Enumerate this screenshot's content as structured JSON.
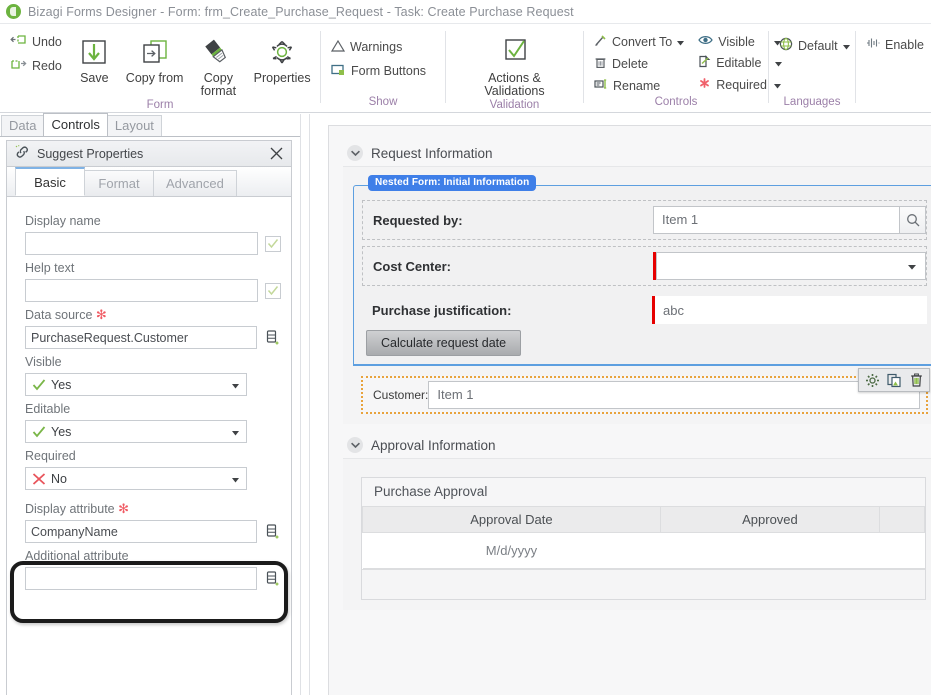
{
  "window": {
    "title": "Bizagi Forms Designer  - Form: frm_Create_Purchase_Request - Task:  Create Purchase Request",
    "logo_icon": "bizagi-logo-icon"
  },
  "ribbon": {
    "groups": [
      {
        "label": "Form",
        "small_items": [
          {
            "label": "Undo",
            "icon": "undo-icon"
          },
          {
            "label": "Redo",
            "icon": "redo-icon"
          }
        ],
        "big_items": [
          {
            "label": "Save",
            "icon": "save-icon"
          },
          {
            "label": "Copy from",
            "icon": "copy-from-icon"
          },
          {
            "label": "Copy format",
            "icon": "copy-format-icon"
          },
          {
            "label": "Properties",
            "icon": "properties-gear-icon"
          }
        ]
      },
      {
        "label": "Show",
        "small_items": [
          {
            "label": "Warnings",
            "icon": "warning-triangle-icon"
          },
          {
            "label": "Form Buttons",
            "icon": "form-buttons-icon"
          }
        ],
        "big_items": []
      },
      {
        "label": "Validation",
        "small_items": [],
        "big_items": [
          {
            "label": "Actions & Validations",
            "icon": "checkmark-box-icon"
          }
        ]
      },
      {
        "label": "Controls",
        "small_items": [
          {
            "label": "Convert To",
            "icon": "convert-to-icon",
            "dropdown": true
          },
          {
            "label": "Delete",
            "icon": "trash-icon",
            "dropdown": false
          },
          {
            "label": "Rename",
            "icon": "rename-icon",
            "dropdown": false
          }
        ],
        "small_items_2": [
          {
            "label": "Visible",
            "icon": "eye-icon",
            "dropdown": true
          },
          {
            "label": "Editable",
            "icon": "editable-page-icon",
            "dropdown": true
          },
          {
            "label": "Required",
            "icon": "required-asterisk-icon",
            "dropdown": true
          }
        ],
        "big_items": []
      },
      {
        "label": "Languages",
        "small_items": [
          {
            "label": "Default",
            "icon": "globe-icon",
            "dropdown": true
          }
        ],
        "big_items": []
      },
      {
        "label": "",
        "small_items": [
          {
            "label": "Enable",
            "icon": "enable-icon",
            "dropdown": false
          }
        ],
        "big_items": []
      }
    ]
  },
  "left_panel": {
    "tabs": [
      {
        "label": "Data",
        "active": false
      },
      {
        "label": "Controls",
        "active": true
      },
      {
        "label": "Layout",
        "active": false
      }
    ],
    "properties": {
      "header_title": "Suggest Properties",
      "header_icon": "suggest-link-icon",
      "close_icon": "close-icon",
      "subtabs": [
        {
          "label": "Basic",
          "active": true
        },
        {
          "label": "Format",
          "active": false
        },
        {
          "label": "Advanced",
          "active": false
        }
      ],
      "fields": [
        {
          "label": "Display name",
          "value": "",
          "type": "text-check",
          "required": false
        },
        {
          "label": "Help text",
          "value": "",
          "type": "text-check",
          "required": false
        },
        {
          "label": "Data source",
          "value": "PurchaseRequest.Customer",
          "type": "text-db",
          "required": true
        },
        {
          "label": "Visible",
          "value": "Yes",
          "type": "select-yes",
          "required": false
        },
        {
          "label": "Editable",
          "value": "Yes",
          "type": "select-yes",
          "required": false
        },
        {
          "label": "Required",
          "value": "No",
          "type": "select-no",
          "required": false
        },
        {
          "label": "Display attribute",
          "value": "CompanyName",
          "type": "text-db",
          "required": true,
          "highlighted": true
        },
        {
          "label": "Additional attribute",
          "value": "",
          "type": "text-db",
          "required": false
        }
      ]
    }
  },
  "form": {
    "sections": [
      {
        "title": "Request Information",
        "collapse_icon": "chevron-down-icon",
        "nested_form_badge": "Nested Form: Initial Information",
        "rows": [
          {
            "label": "Requested by:",
            "value": "Item 1",
            "control": "search",
            "required": false,
            "icon": "search-icon"
          },
          {
            "label": "Cost Center:",
            "value": "",
            "control": "dropdown",
            "required": true,
            "icon": "chevron-down-icon"
          },
          {
            "label": "Purchase justification:",
            "value": "abc",
            "control": "text",
            "required": true
          }
        ],
        "button": {
          "label": "Calculate request date"
        },
        "selected_row": {
          "label": "Customer:",
          "value": "Item 1",
          "tools": [
            {
              "icon": "gear-icon",
              "name": "configure"
            },
            {
              "icon": "duplicate-icon",
              "name": "duplicate"
            },
            {
              "icon": "trash-icon",
              "name": "delete"
            }
          ]
        }
      },
      {
        "title": "Approval Information",
        "collapse_icon": "chevron-down-icon",
        "table": {
          "caption": "Purchase Approval",
          "columns": [
            "Approval Date",
            "Approved",
            ""
          ],
          "rows": [
            [
              "M/d/yyyy",
              "",
              ""
            ]
          ]
        }
      }
    ]
  },
  "colors": {
    "brand_green": "#6cb33f",
    "accent_blue": "#3f7fe8",
    "required_red": "#e60000",
    "star_red": "#f05a63",
    "group_label": "#9b7fa8",
    "selection_orange": "#e8a33d"
  }
}
